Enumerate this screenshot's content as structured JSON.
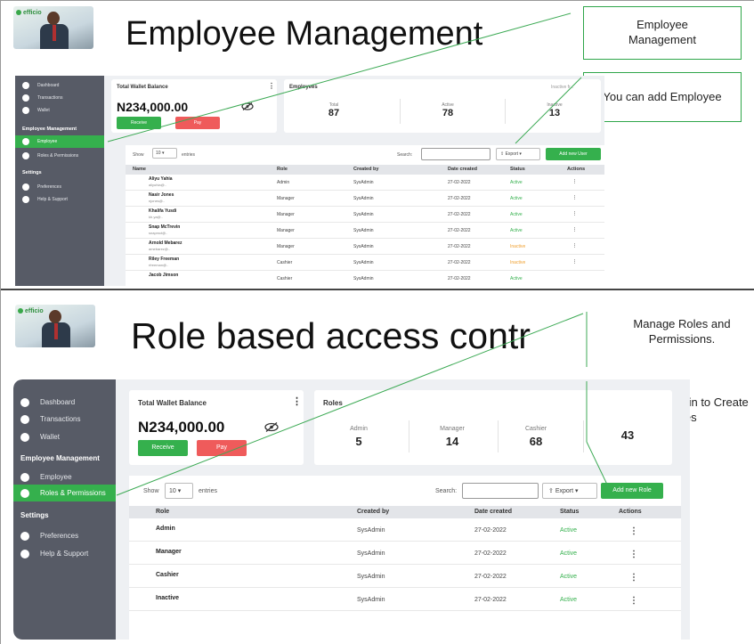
{
  "colors": {
    "accent": "#35b04d",
    "danger": "#ef5b5b",
    "sidebar": "#575b66"
  },
  "section1": {
    "hero_title": "Employee Management",
    "logo_brand": "efficio",
    "callout_top": "Employee Management",
    "callout_mid": "You can add Employee",
    "sidebar": {
      "items": [
        "Dashboard",
        "Transactions",
        "Wallet"
      ],
      "heading_employee": "Employee Management",
      "employee_items": [
        "Employee",
        "Roles & Permissions"
      ],
      "heading_settings": "Settings",
      "settings_items": [
        "Preferences",
        "Help & Support"
      ]
    },
    "wallet": {
      "title": "Total Wallet Balance",
      "kebab": "⋮",
      "amount": "N234,000.00",
      "receive": "Receive",
      "pay": "Pay"
    },
    "employees_card": {
      "title": "Employees",
      "overflow": "Inactive fr...",
      "stats": [
        {
          "label": "Total",
          "value": "87"
        },
        {
          "label": "Active",
          "value": "78"
        },
        {
          "label": "Inactive",
          "value": "13"
        }
      ]
    },
    "toolbar": {
      "show": "Show",
      "entries_value": "10",
      "entries": "entries",
      "search": "Search:",
      "export": "Export",
      "add_button": "Add new User"
    },
    "table": {
      "headers": [
        "Name",
        "Role",
        "Created by",
        "Date created",
        "Status",
        "Actions"
      ],
      "rows": [
        {
          "name": "Aliyu Yahia",
          "email": "aliyuhia@..",
          "role": "Admin",
          "created_by": "SysAdmin",
          "date": "27-02-2022",
          "status": "Active",
          "actions": "⋮"
        },
        {
          "name": "Nasir Jones",
          "email": "njones@..",
          "role": "Manager",
          "created_by": "SysAdmin",
          "date": "27-02-2022",
          "status": "Active",
          "actions": "⋮"
        },
        {
          "name": "Khalifa Yusdi",
          "email": "kh.ya@..",
          "role": "Manager",
          "created_by": "SysAdmin",
          "date": "27-02-2022",
          "status": "Active",
          "actions": "⋮"
        },
        {
          "name": "Snap McTrevin",
          "email": "snapmct@..",
          "role": "Manager",
          "created_by": "SysAdmin",
          "date": "27-02-2022",
          "status": "Active",
          "actions": "⋮"
        },
        {
          "name": "Arnold Mebarez",
          "email": "amebarez@..",
          "role": "Manager",
          "created_by": "SysAdmin",
          "date": "27-02-2022",
          "status": "Inactive",
          "actions": "⋮"
        },
        {
          "name": "Riley Freeman",
          "email": "rfreeman@..",
          "role": "Cashier",
          "created_by": "SysAdmin",
          "date": "27-02-2022",
          "status": "Inactive",
          "actions": "⋮"
        },
        {
          "name": "Jacob Jimson",
          "email": "",
          "role": "Cashier",
          "created_by": "SysAdmin",
          "date": "27-02-2022",
          "status": "Active",
          "actions": ""
        }
      ]
    }
  },
  "section2": {
    "hero_title": "Role based access contr",
    "logo_brand": "efficio",
    "callout_top": "Manage Roles and Permissions.",
    "callout_bottom": "Log in as Admin to Create Roles",
    "sidebar": {
      "items": [
        "Dashboard",
        "Transactions",
        "Wallet"
      ],
      "heading_employee": "Employee Management",
      "employee_items": [
        "Employee",
        "Roles & Permissions"
      ],
      "heading_settings": "Settings",
      "settings_items": [
        "Preferences",
        "Help & Support"
      ]
    },
    "wallet": {
      "title": "Total Wallet Balance",
      "kebab": "⋮",
      "amount": "N234,000.00",
      "receive": "Receive",
      "pay": "Pay"
    },
    "roles_card": {
      "title": "Roles",
      "stats": [
        {
          "label": "Admin",
          "value": "5"
        },
        {
          "label": "Manager",
          "value": "14"
        },
        {
          "label": "Cashier",
          "value": "68"
        },
        {
          "label": "",
          "value": "43"
        }
      ]
    },
    "toolbar": {
      "show": "Show",
      "entries_value": "10",
      "entries": "entries",
      "search": "Search:",
      "export": "Export",
      "add_button": "Add new Role"
    },
    "table": {
      "headers": [
        "Role",
        "Created by",
        "Date created",
        "Status",
        "Actions"
      ],
      "rows": [
        {
          "role": "Admin",
          "created_by": "SysAdmin",
          "date": "27-02-2022",
          "status": "Active",
          "actions": "⋮"
        },
        {
          "role": "Manager",
          "created_by": "SysAdmin",
          "date": "27-02-2022",
          "status": "Active",
          "actions": "⋮"
        },
        {
          "role": "Cashier",
          "created_by": "SysAdmin",
          "date": "27-02-2022",
          "status": "Active",
          "actions": "⋮"
        },
        {
          "role": "Inactive",
          "created_by": "SysAdmin",
          "date": "27-02-2022",
          "status": "Active",
          "actions": "⋮"
        }
      ]
    }
  }
}
